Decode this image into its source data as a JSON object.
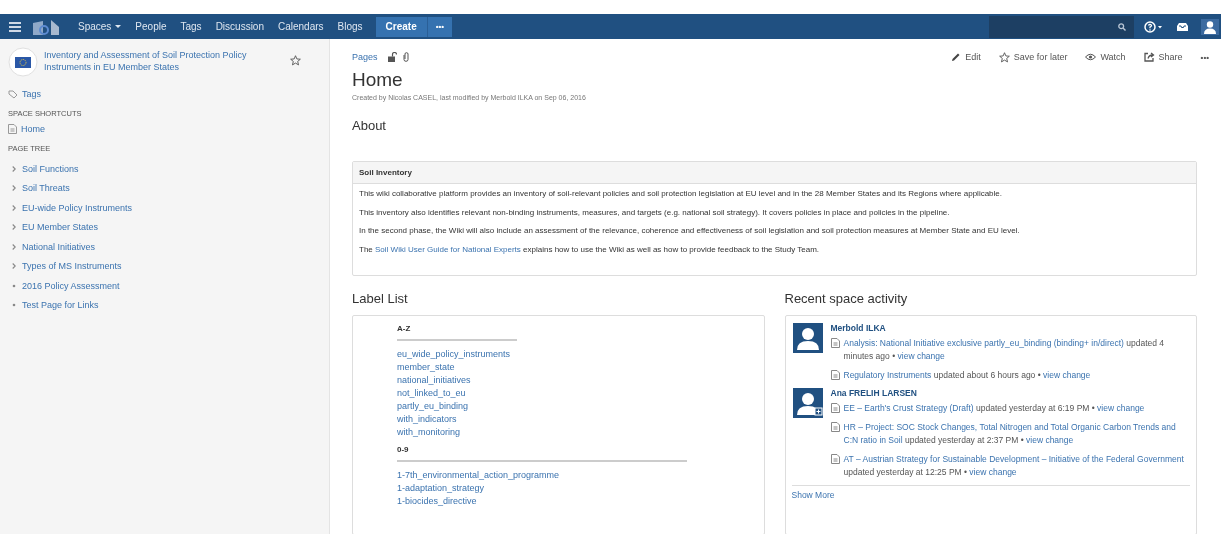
{
  "topbar": {
    "nav": [
      {
        "label": "Spaces",
        "dropdown": true
      },
      {
        "label": "People",
        "dropdown": false
      },
      {
        "label": "Tags",
        "dropdown": false
      },
      {
        "label": "Discussion",
        "dropdown": false
      },
      {
        "label": "Calendars",
        "dropdown": false
      },
      {
        "label": "Blogs",
        "dropdown": false
      }
    ],
    "create": "Create",
    "more": "•••"
  },
  "sidebar": {
    "space_title": "Inventory and Assessment of Soil Protection Policy Instruments in EU Member States",
    "tags": "Tags",
    "shortcuts_heading": "SPACE SHORTCUTS",
    "shortcuts": [
      "Home"
    ],
    "tree_heading": "PAGE TREE",
    "tree": [
      {
        "label": "Soil Functions",
        "has_children": true
      },
      {
        "label": "Soil Threats",
        "has_children": true
      },
      {
        "label": "EU-wide Policy Instruments",
        "has_children": true
      },
      {
        "label": "EU Member States",
        "has_children": true
      },
      {
        "label": "National Initiatives",
        "has_children": true
      },
      {
        "label": "Types of MS Instruments",
        "has_children": true
      },
      {
        "label": "2016 Policy Assessment",
        "has_children": false
      },
      {
        "label": "Test Page for Links",
        "has_children": false
      }
    ]
  },
  "page": {
    "breadcrumb": "Pages",
    "actions": [
      {
        "kind": "edit",
        "label": "Edit"
      },
      {
        "kind": "save",
        "label": "Save for later"
      },
      {
        "kind": "watch",
        "label": "Watch"
      },
      {
        "kind": "share",
        "label": "Share"
      }
    ],
    "more": "•••",
    "title": "Home",
    "byline": "Created by Nicolas CASEL, last modified by Merbold ILKA on Sep 06, 2016",
    "about": "About"
  },
  "panel": {
    "title": "Soil Inventory",
    "paragraphs": [
      {
        "text": "This wiki collaborative platform provides an inventory of soil-relevant policies and soil protection legislation at EU level and in the 28 Member States and its Regions where applicable."
      },
      {
        "text": "This inventory also identifies relevant non-binding instruments, measures, and targets (e.g. national soil strategy). It covers policies in place and policies in the pipeline."
      },
      {
        "text": "In the second phase, the Wiki will also include an assessment of the relevance, coherence and effectiveness of soil legislation and soil protection measures at Member State and EU level."
      },
      {
        "text": "The ",
        "link": "Soil Wiki User Guide for National Experts",
        "after": " explains how to use the Wiki as well as how to provide feedback to the Study Team."
      }
    ]
  },
  "label_list": {
    "title": "Label List",
    "groups": [
      {
        "heading": "A-Z",
        "labels": [
          "eu_wide_policy_instruments",
          "member_state",
          "national_initiatives",
          "not_linked_to_eu",
          "partly_eu_binding",
          "with_indicators",
          "with_monitoring"
        ]
      },
      {
        "heading": "0-9",
        "labels": [
          "1-7th_environmental_action_programme",
          "1-adaptation_strategy",
          "1-biocides_directive"
        ]
      }
    ]
  },
  "activity": {
    "title": "Recent space activity",
    "users": [
      {
        "name": "Merbold ILKA",
        "badge": false,
        "items": [
          {
            "page": "Analysis: National Initiative exclusive partly_eu_binding (binding+ in/direct)",
            "meta": " updated 4 minutes ago • ",
            "link": "view change"
          },
          {
            "page": "Regulatory Instruments",
            "meta": " updated about 6 hours ago • ",
            "link": "view change"
          }
        ]
      },
      {
        "name": "Ana FRELIH LARSEN",
        "badge": true,
        "items": [
          {
            "page": "EE – Earth's Crust Strategy (Draft)",
            "meta": " updated yesterday at 6:19 PM • ",
            "link": "view change"
          },
          {
            "page": "HR – Project: SOC Stock Changes, Total Nitrogen and Total Organic Carbon Trends and C:N ratio in Soil",
            "meta": " updated yesterday at 2:37 PM • ",
            "link": "view change"
          },
          {
            "page": "AT – Austrian Strategy for Sustainable Development – Initiative of the Federal Government",
            "meta": " updated yesterday at 12:25 PM • ",
            "link": "view change"
          }
        ]
      }
    ],
    "show_more": "Show More"
  }
}
